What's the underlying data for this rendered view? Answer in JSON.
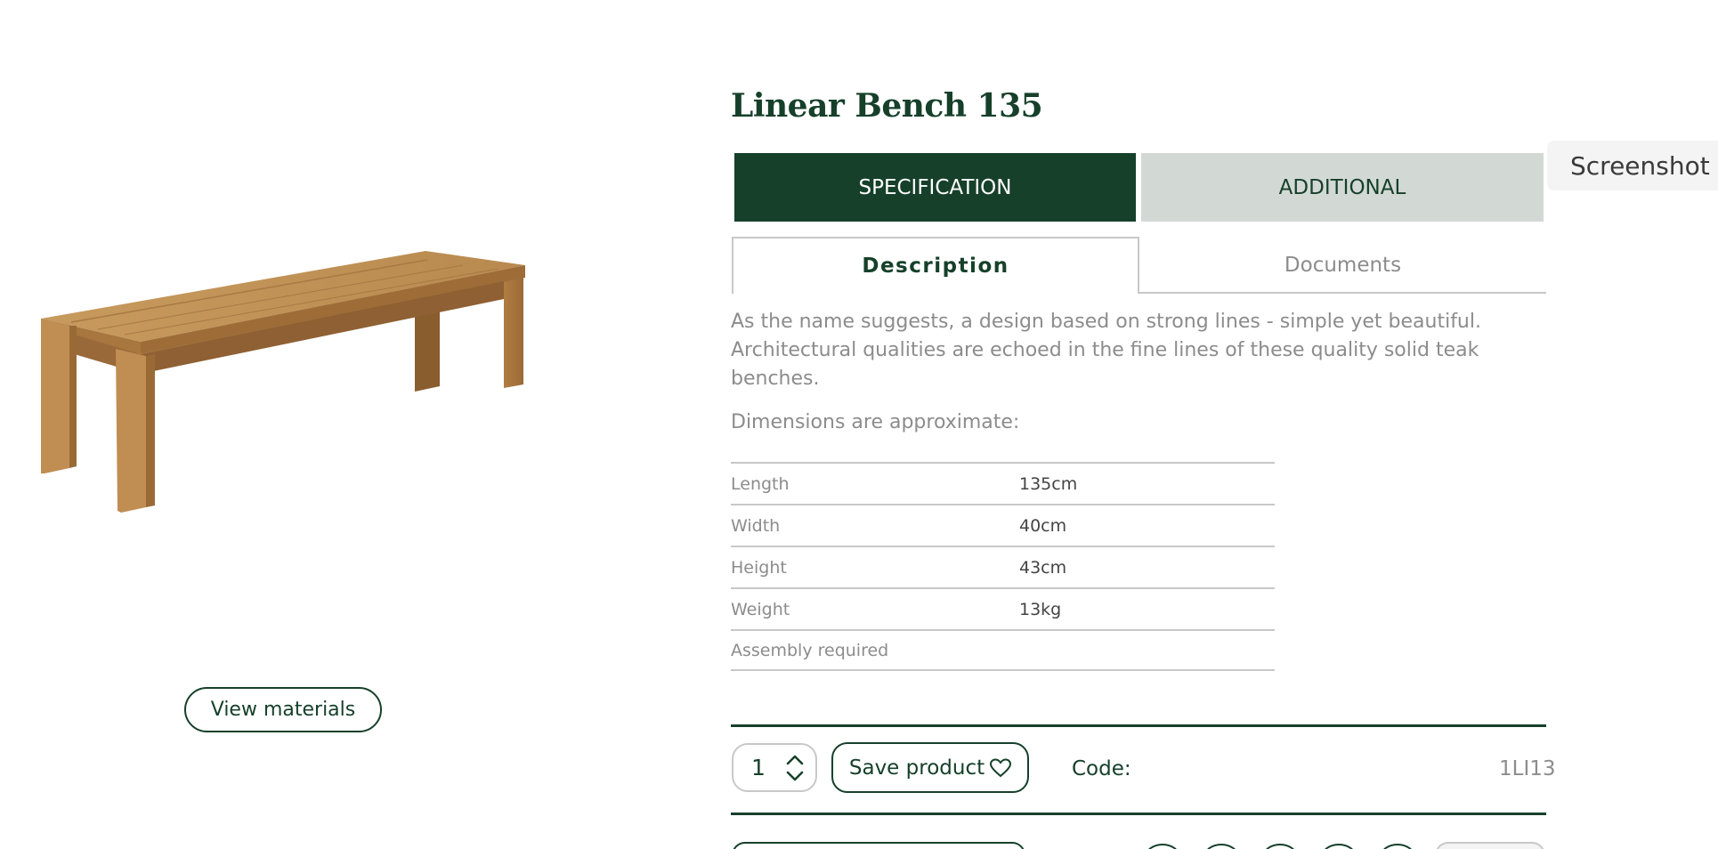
{
  "product": {
    "title": "Linear Bench 135",
    "image_alt": "Teak bench",
    "view_materials_label": "View materials"
  },
  "tabs": {
    "main": [
      {
        "label": "SPECIFICATION",
        "active": true
      },
      {
        "label": "ADDITIONAL",
        "active": false
      }
    ],
    "sub": [
      {
        "label": "Description",
        "active": true
      },
      {
        "label": "Documents",
        "active": false
      }
    ]
  },
  "overlay": {
    "screenshot_label": "Screenshot"
  },
  "description": {
    "text": "As the name suggests, a design based on strong lines - simple yet beautiful. Architectural qualities are echoed in the fine lines of these quality solid teak benches.",
    "dimensions_heading": "Dimensions are approximate:"
  },
  "specs": [
    {
      "label": "Length",
      "value": "135cm"
    },
    {
      "label": "Width",
      "value": "40cm"
    },
    {
      "label": "Height",
      "value": "43cm"
    },
    {
      "label": "Weight",
      "value": "13kg"
    },
    {
      "label": "Assembly required",
      "value": ""
    }
  ],
  "purchase": {
    "quantity": "1",
    "save_label": "Save product",
    "code_label": "Code:",
    "code_value": "1LI13"
  },
  "colors": {
    "brand_green": "#16402a",
    "inactive_tab": "#d2d9d4",
    "muted_text": "#8c8c8c",
    "wood": "#b98a4f"
  },
  "icons": {
    "save": "heart-icon",
    "stepper": "chevron-up-down-icon"
  }
}
